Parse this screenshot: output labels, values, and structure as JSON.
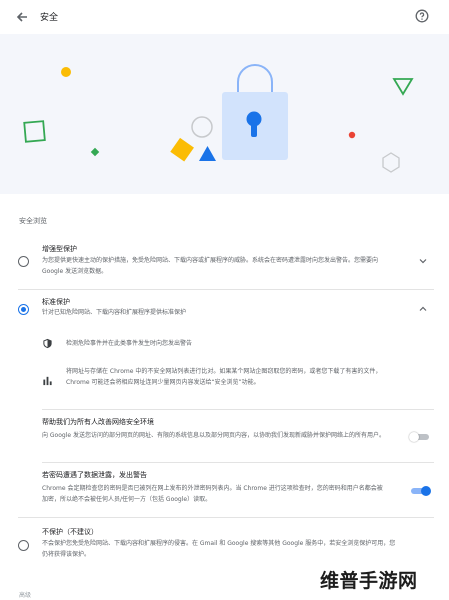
{
  "header": {
    "title": "安全"
  },
  "section": {
    "label": "安全浏览"
  },
  "options": {
    "enhanced": {
      "title": "增强型保护",
      "desc": "为您提供更快速主动的保护措施，免受危险网站、下载内容或扩展程序的威胁。系统会在密码遭泄露时向您发出警告。您需要向 Google 发送浏览数据。",
      "selected": false
    },
    "standard": {
      "title": "标准保护",
      "desc": "针对已知危险网站、下载内容和扩展程序提供标准保护",
      "selected": true,
      "features": [
        {
          "icon": "shield-icon",
          "text": "检测危险事件并在此类事件发生时向您发出警告"
        },
        {
          "icon": "bar-chart-icon",
          "text": "将网址与存储在 Chrome 中的不安全网站列表进行比对。如果某个网站企图窃取您的密码，或者您下载了有害的文件，Chrome 可能还会将相应网址连同少量网页内容发送给“安全浏览”功能。"
        }
      ],
      "settings": [
        {
          "title": "帮助我们为所有人改善网络安全环境",
          "desc": "向 Google 发送您访问的部分网页的网址、有限的系统信息以及部分网页内容，以协助我们发现新威胁并保护网络上的所有用户。",
          "enabled": false
        },
        {
          "title": "若密码遭遇了数据泄露，发出警告",
          "desc": "Chrome 会定期检查您的密码是否已被列在网上发布的外泄密码列表内。当 Chrome 进行这项检查时，您的密码和用户名都会被加密，所以绝不会被任何人员/任何一方（包括 Google）读取。",
          "enabled": true
        }
      ]
    },
    "none": {
      "title": "不保护（不建议）",
      "desc": "不会保护您免受危险网站、下载内容和扩展程序的侵害。在 Gmail 和 Google 搜索等其他 Google 服务中，若安全浏览保护可用，您仍将获得该保护。",
      "selected": false
    }
  },
  "footer": {
    "cut_label": "高级"
  },
  "watermark": "维普手游网",
  "colors": {
    "accent": "#1a73e8",
    "hero_bg": "#f4f6fb",
    "lock_blue": "#d2e3fc",
    "yellow": "#fbbc04",
    "green": "#34a853",
    "red": "#ea4335"
  }
}
